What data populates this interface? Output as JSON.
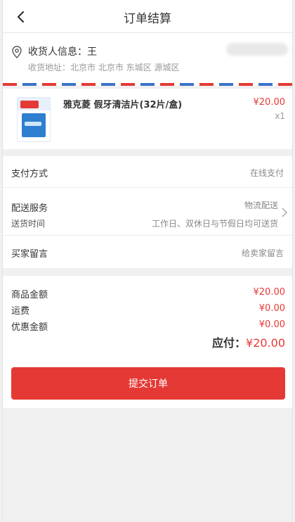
{
  "header": {
    "title": "订单结算"
  },
  "address": {
    "name_line": "收货人信息：王",
    "address_line": "收货地址：北京市 北京市 东城区 源城区"
  },
  "product": {
    "name": "雅克菱 假牙清洁片(32片/盒)",
    "price": "¥20.00",
    "quantity": "x1"
  },
  "options": {
    "payment_label": "支付方式",
    "payment_value": "在线支付",
    "delivery_label": "配送服务",
    "delivery_value": "物流配送",
    "delivery_time_label": "送货时间",
    "delivery_time_value": "工作日、双休日与节假日均可送货",
    "message_label": "买家留言",
    "message_placeholder": "给卖家留言"
  },
  "summary": {
    "goods_label": "商品金额",
    "goods_value": "¥20.00",
    "shipping_label": "运费",
    "shipping_value": "¥0.00",
    "discount_label": "优惠金额",
    "discount_value": "¥0.00",
    "total_label": "应付：",
    "total_value": "¥20.00"
  },
  "actions": {
    "submit_label": "提交订单"
  },
  "colors": {
    "accent": "#e53935",
    "stripe_blue": "#3b73c8"
  }
}
